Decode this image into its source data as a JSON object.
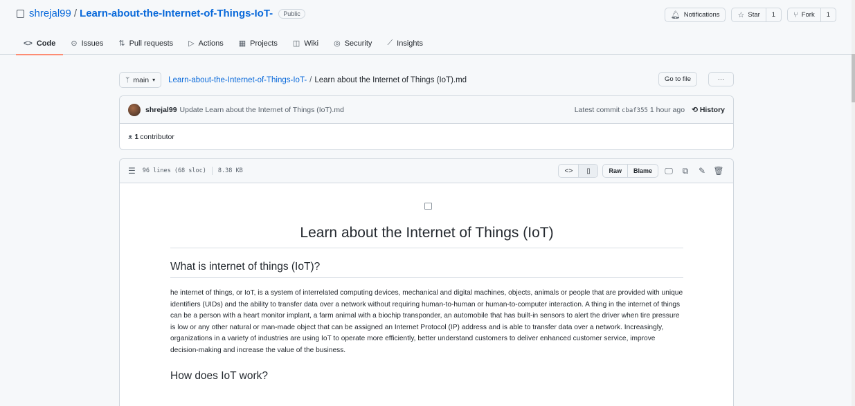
{
  "repo": {
    "owner": "shrejal99",
    "separator": "/",
    "name": "Learn-about-the-Internet-of-Things-IoT-",
    "visibility": "Public"
  },
  "header_actions": {
    "notifications": "Notifications",
    "star": "Star",
    "star_count": "1",
    "fork": "Fork",
    "fork_count": "1"
  },
  "tabs": [
    {
      "label": "Code",
      "icon": "code-icon",
      "glyph": "<>"
    },
    {
      "label": "Issues",
      "icon": "issue-icon",
      "glyph": "⊙"
    },
    {
      "label": "Pull requests",
      "icon": "pull-request-icon",
      "glyph": "⇅"
    },
    {
      "label": "Actions",
      "icon": "play-icon",
      "glyph": "▷"
    },
    {
      "label": "Projects",
      "icon": "table-icon",
      "glyph": "▦"
    },
    {
      "label": "Wiki",
      "icon": "book-icon",
      "glyph": "◫"
    },
    {
      "label": "Security",
      "icon": "shield-icon",
      "glyph": "◎"
    },
    {
      "label": "Insights",
      "icon": "graph-icon",
      "glyph": "⟋"
    }
  ],
  "breadcrumb": {
    "branch": "main",
    "repo_link": "Learn-about-the-Internet-of-Things-IoT-",
    "slash": "/",
    "file": "Learn about the Internet of Things (IoT).md",
    "go_to_file": "Go to file",
    "more": "···"
  },
  "commit": {
    "author": "shrejal99",
    "message": "Update Learn about the Internet of Things (IoT).md",
    "latest_label": "Latest commit",
    "sha": "cbaf355",
    "time": "1 hour ago",
    "history": "History"
  },
  "contributors": {
    "count": "1",
    "label": "contributor"
  },
  "file_header": {
    "lines": "96 lines (68 sloc)",
    "size": "8.38 KB",
    "raw": "Raw",
    "blame": "Blame"
  },
  "content": {
    "h1": "Learn about the Internet of Things (IoT)",
    "h2_what": "What is internet of things (IoT)?",
    "paragraph": "he internet of things, or IoT, is a system of interrelated computing devices, mechanical and digital machines, objects, animals or people that are provided with unique identifiers (UIDs) and the ability to transfer data over a network without requiring human-to-human or human-to-computer interaction. A thing in the internet of things can be a person with a heart monitor implant, a farm animal with a biochip transponder, an automobile that has built-in sensors to alert the driver when tire pressure is low or any other natural or man-made object that can be assigned an Internet Protocol (IP) address and is able to transfer data over a network. Increasingly, organizations in a variety of industries are using IoT to operate more efficiently, better understand customers to deliver enhanced customer service, improve decision-making and increase the value of the business.",
    "h2_how": "How does IoT work?"
  }
}
